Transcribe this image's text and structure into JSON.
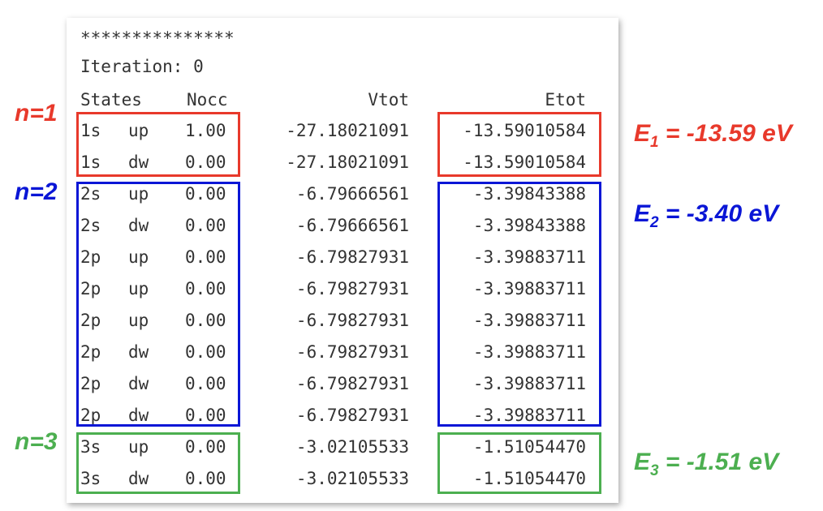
{
  "output": {
    "stars": "***************",
    "iteration_line": "Iteration: 0",
    "headers": {
      "states": "States",
      "nocc": "Nocc",
      "vtot": "Vtot",
      "etot": "Etot"
    },
    "rows": [
      {
        "orbital": "1s",
        "spin": "up",
        "nocc": "1.00",
        "vtot": "-27.18021091",
        "etot": "-13.59010584"
      },
      {
        "orbital": "1s",
        "spin": "dw",
        "nocc": "0.00",
        "vtot": "-27.18021091",
        "etot": "-13.59010584"
      },
      {
        "orbital": "2s",
        "spin": "up",
        "nocc": "0.00",
        "vtot": "-6.79666561",
        "etot": "-3.39843388"
      },
      {
        "orbital": "2s",
        "spin": "dw",
        "nocc": "0.00",
        "vtot": "-6.79666561",
        "etot": "-3.39843388"
      },
      {
        "orbital": "2p",
        "spin": "up",
        "nocc": "0.00",
        "vtot": "-6.79827931",
        "etot": "-3.39883711"
      },
      {
        "orbital": "2p",
        "spin": "up",
        "nocc": "0.00",
        "vtot": "-6.79827931",
        "etot": "-3.39883711"
      },
      {
        "orbital": "2p",
        "spin": "up",
        "nocc": "0.00",
        "vtot": "-6.79827931",
        "etot": "-3.39883711"
      },
      {
        "orbital": "2p",
        "spin": "dw",
        "nocc": "0.00",
        "vtot": "-6.79827931",
        "etot": "-3.39883711"
      },
      {
        "orbital": "2p",
        "spin": "dw",
        "nocc": "0.00",
        "vtot": "-6.79827931",
        "etot": "-3.39883711"
      },
      {
        "orbital": "2p",
        "spin": "dw",
        "nocc": "0.00",
        "vtot": "-6.79827931",
        "etot": "-3.39883711"
      },
      {
        "orbital": "3s",
        "spin": "up",
        "nocc": "0.00",
        "vtot": "-3.02105533",
        "etot": "-1.51054470"
      },
      {
        "orbital": "3s",
        "spin": "dw",
        "nocc": "0.00",
        "vtot": "-3.02105533",
        "etot": "-1.51054470"
      }
    ]
  },
  "annotations": {
    "shells": [
      {
        "label": "n=1",
        "color": "#e8392b"
      },
      {
        "label": "n=2",
        "color": "#0a16d6"
      },
      {
        "label": "n=3",
        "color": "#4caf50"
      }
    ],
    "energies": [
      {
        "symbol": "E",
        "sub": "1",
        "value": " = -13.59 eV",
        "color": "#e8392b"
      },
      {
        "symbol": "E",
        "sub": "2",
        "value": " = -3.40 eV",
        "color": "#0a16d6"
      },
      {
        "symbol": "E",
        "sub": "3",
        "value": " = -1.51 eV",
        "color": "#4caf50"
      }
    ]
  }
}
